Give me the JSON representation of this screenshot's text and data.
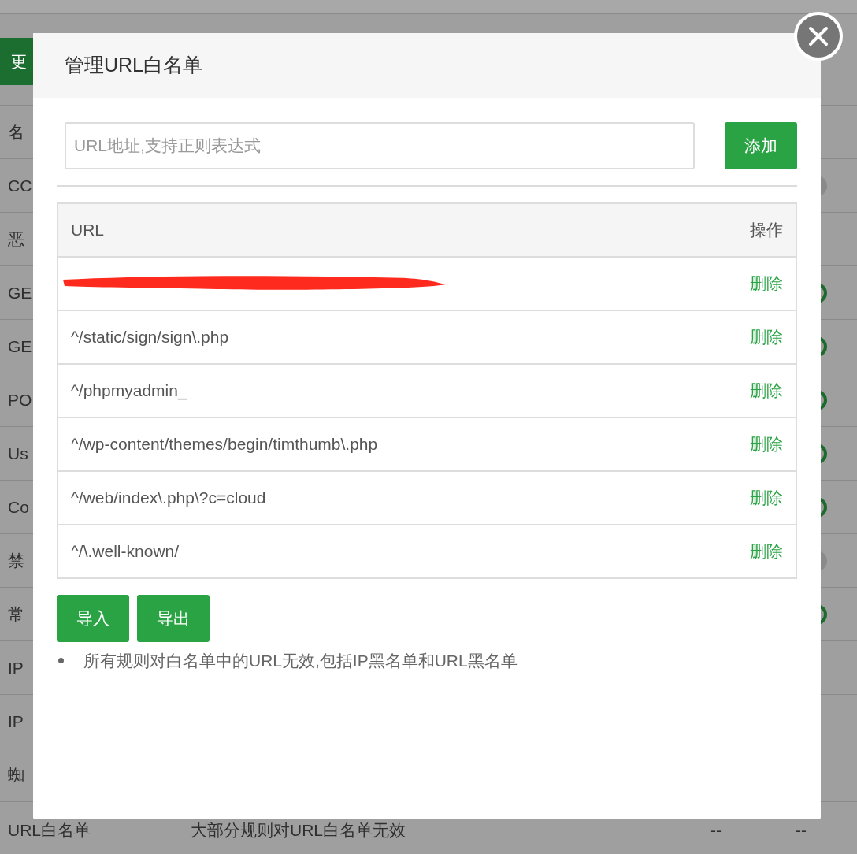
{
  "background": {
    "update_button": "更",
    "header": {
      "column_1": "名"
    },
    "rows": [
      {
        "name": "CC",
        "on": false
      },
      {
        "name": "恶"
      },
      {
        "name": "GE",
        "on": true
      },
      {
        "name": "GE",
        "on": true
      },
      {
        "name": "PO",
        "on": true
      },
      {
        "name": "Us",
        "on": true
      },
      {
        "name": "Co",
        "on": true
      },
      {
        "name": "禁",
        "on": false
      },
      {
        "name": "常",
        "on": true
      },
      {
        "name": "IP"
      },
      {
        "name": "IP"
      },
      {
        "name": "蜘"
      }
    ],
    "last_row": {
      "name": "URL白名单",
      "description": "大部分规则对URL白名单无效",
      "column_3": "--",
      "column_4": "--"
    }
  },
  "dialog": {
    "title": "管理URL白名单",
    "input": {
      "placeholder": "URL地址,支持正则表达式"
    },
    "add_button": "添加",
    "table": {
      "columns": [
        "URL",
        "操作"
      ],
      "rows": [
        {
          "kind": "redacted",
          "action": "删除"
        },
        {
          "kind": "text",
          "url": "^/static/sign/sign\\.php",
          "action": "删除"
        },
        {
          "kind": "text",
          "url": "^/phpmyadmin_",
          "action": "删除"
        },
        {
          "kind": "text",
          "url": "^/wp-content/themes/begin/timthumb\\.php",
          "action": "删除"
        },
        {
          "kind": "text",
          "url": "^/web/index\\.php\\?c=cloud",
          "action": "删除"
        },
        {
          "kind": "text",
          "url": "^/\\.well-known/",
          "action": "删除"
        }
      ]
    },
    "buttons": [
      "导入",
      "导出"
    ],
    "notes": [
      "所有规则对白名单中的URL无效,包括IP黑名单和URL黑名单"
    ]
  }
}
